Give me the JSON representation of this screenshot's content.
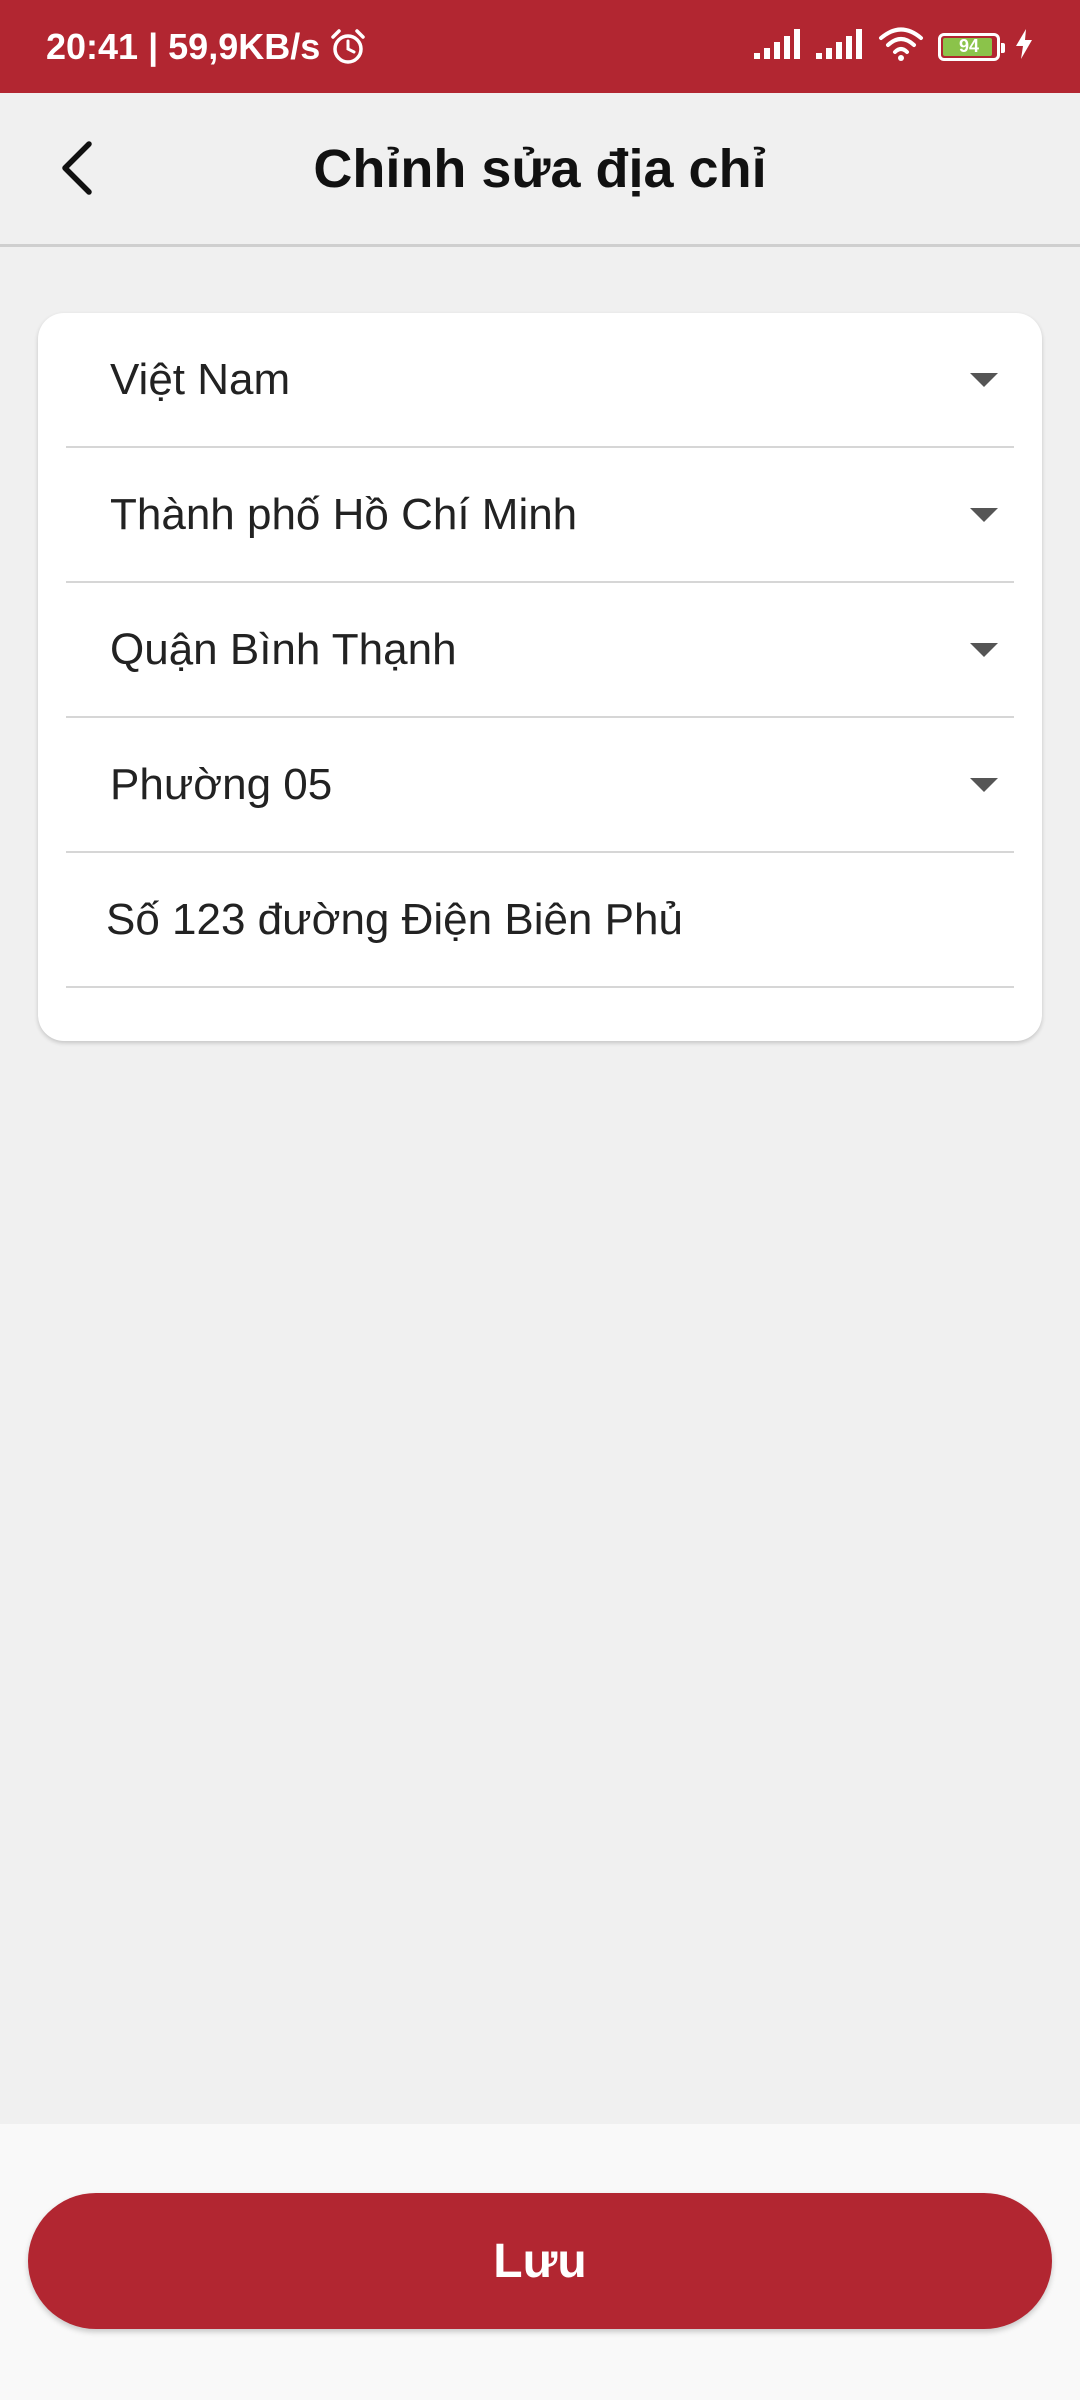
{
  "status_bar": {
    "time": "20:41",
    "network_speed": "| 59,9KB/s",
    "battery_level": "94",
    "battery_fraction": 0.94,
    "icons": [
      "alarm-icon",
      "signal-icon",
      "signal-icon",
      "wifi-icon",
      "battery-icon",
      "charging-icon"
    ]
  },
  "header": {
    "title": "Chỉnh sửa địa chỉ",
    "back_icon": "chevron-left-icon"
  },
  "form": {
    "country": "Việt Nam",
    "city": "Thành phố Hồ Chí Minh",
    "district": "Quận Bình Thạnh",
    "ward": "Phường 05",
    "street": "Số 123 đường Điện Biên Phủ"
  },
  "actions": {
    "save_label": "Lưu"
  },
  "colors": {
    "brand": "#b22631",
    "background": "#f0f0f0",
    "card": "#ffffff"
  }
}
